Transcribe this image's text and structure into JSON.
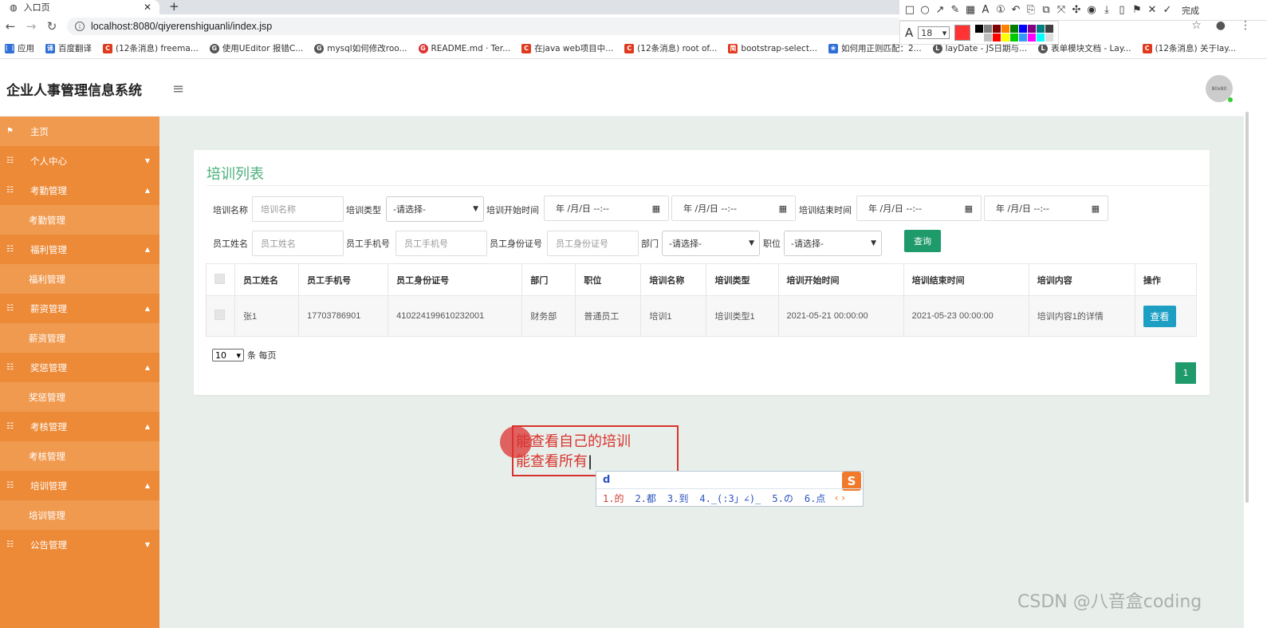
{
  "browser": {
    "tab_title": "入口页",
    "tab_close": "✕",
    "new_tab": "+",
    "url": "localhost:8080/qiyerenshiguanli/index.jsp",
    "bookmarks": [
      {
        "label": "应用",
        "icon": "apps-icon",
        "glyph": "⋮⋮"
      },
      {
        "label": "百度翻译",
        "icon": "baidu-translate-icon",
        "glyph": "译"
      },
      {
        "label": "(12条消息) freema...",
        "icon": "csdn-icon",
        "glyph": "C"
      },
      {
        "label": "使用UEditor 报错C...",
        "icon": "github-icon",
        "glyph": "G"
      },
      {
        "label": "mysql如何修改roo...",
        "icon": "github-icon",
        "glyph": "G"
      },
      {
        "label": "README.md · Ter...",
        "icon": "gitee-icon",
        "glyph": "G"
      },
      {
        "label": "在java web项目中...",
        "icon": "csdn-icon",
        "glyph": "C"
      },
      {
        "label": "(12条消息) root of...",
        "icon": "csdn-icon",
        "glyph": "C"
      },
      {
        "label": "bootstrap-select...",
        "icon": "jianshu-icon",
        "glyph": "简"
      },
      {
        "label": "如何用正则匹配：2...",
        "icon": "baidu-icon",
        "glyph": "❀"
      },
      {
        "label": "layDate - JS日期与...",
        "icon": "layui-icon",
        "glyph": "L"
      },
      {
        "label": "表单模块文档 - Lay...",
        "icon": "layui-icon",
        "glyph": "L"
      },
      {
        "label": "(12条消息) 关于lay...",
        "icon": "csdn-icon",
        "glyph": "C"
      }
    ]
  },
  "snap_tool": {
    "tools": [
      "□",
      "○",
      "↗",
      "✎",
      "▦",
      "A",
      "①",
      "↶",
      "⎘",
      "⧉",
      "⤧",
      "✣",
      "◉",
      "⤓",
      "▯",
      "⚑",
      "✕",
      "✓"
    ],
    "done_label": "完成",
    "font_size": "18",
    "current_color": "#ff3333",
    "palette": [
      "#000000",
      "#808080",
      "#800000",
      "#ff8000",
      "#008000",
      "#0000ff",
      "#800080",
      "#008080",
      "#404040",
      "#ffffff",
      "#c0c0c0",
      "#ff0000",
      "#ffff00",
      "#00cc00",
      "#3399ff",
      "#ff00ff",
      "#00ffff",
      "#dddddd"
    ]
  },
  "app": {
    "title": "企业人事管理信息系统",
    "menu_icon": "≡",
    "avatar_text": "80x80"
  },
  "sidebar": {
    "items": [
      {
        "label": "主页",
        "type": "home"
      },
      {
        "label": "个人中心",
        "type": "main",
        "caret": "▼"
      },
      {
        "label": "考勤管理",
        "type": "main",
        "caret": "▲"
      },
      {
        "label": "考勤管理",
        "type": "sub"
      },
      {
        "label": "福利管理",
        "type": "main",
        "caret": "▲"
      },
      {
        "label": "福利管理",
        "type": "sub"
      },
      {
        "label": "薪资管理",
        "type": "main",
        "caret": "▲"
      },
      {
        "label": "薪资管理",
        "type": "sub"
      },
      {
        "label": "奖惩管理",
        "type": "main",
        "caret": "▲"
      },
      {
        "label": "奖惩管理",
        "type": "sub"
      },
      {
        "label": "考核管理",
        "type": "main",
        "caret": "▲"
      },
      {
        "label": "考核管理",
        "type": "sub"
      },
      {
        "label": "培训管理",
        "type": "main",
        "caret": "▲"
      },
      {
        "label": "培训管理",
        "type": "sub"
      },
      {
        "label": "公告管理",
        "type": "main",
        "caret": "▼"
      }
    ]
  },
  "card": {
    "title": "培训列表",
    "filters": {
      "train_name_label": "培训名称",
      "train_name_placeholder": "培训名称",
      "train_type_label": "培训类型",
      "train_type_value": "-请选择-",
      "start_time_label": "培训开始时间",
      "end_time_label": "培训结束时间",
      "date_placeholder": "年 /月/日 --:--",
      "emp_name_label": "员工姓名",
      "emp_name_placeholder": "员工姓名",
      "emp_phone_label": "员工手机号",
      "emp_phone_placeholder": "员工手机号",
      "emp_id_label": "员工身份证号",
      "emp_id_placeholder": "员工身份证号",
      "dept_label": "部门",
      "dept_value": "-请选择-",
      "position_label": "职位",
      "position_value": "-请选择-",
      "query_label": "查询"
    },
    "table": {
      "headers": [
        "员工姓名",
        "员工手机号",
        "员工身份证号",
        "部门",
        "职位",
        "培训名称",
        "培训类型",
        "培训开始时间",
        "培训结束时间",
        "培训内容",
        "操作"
      ],
      "rows": [
        [
          "张1",
          "17703786901",
          "410224199610232001",
          "财务部",
          "普通员工",
          "培训1",
          "培训类型1",
          "2021-05-21 00:00:00",
          "2021-05-23 00:00:00",
          "培训内容1的详情"
        ]
      ],
      "view_label": "查看"
    },
    "page_size": "10",
    "page_size_suffix": "条 每页",
    "current_page": "1"
  },
  "annotation": {
    "line1": "能查看自己的培训",
    "line2": "能查看所有"
  },
  "ime": {
    "input": "d",
    "logo": "S",
    "candidates": [
      "1.的",
      "2.都",
      "3.到",
      "4._(:3」∠)_",
      "5.の",
      "6.点"
    ],
    "arrows": "‹ ›"
  },
  "watermark": "CSDN @八音盒coding"
}
